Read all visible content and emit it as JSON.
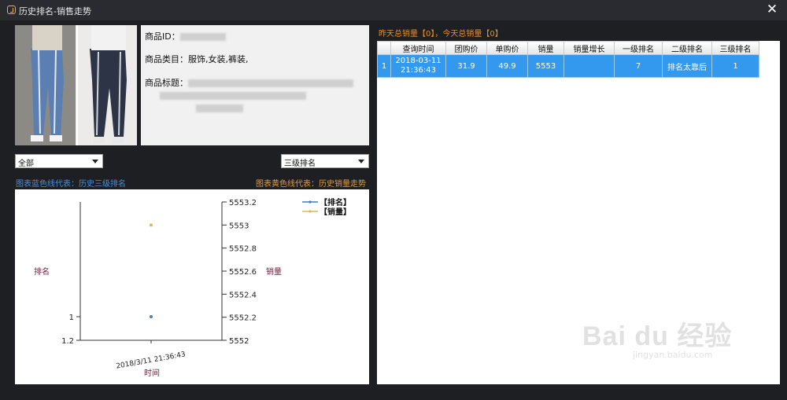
{
  "window": {
    "title": "历史排名-销售走势",
    "close_glyph": "✕"
  },
  "product": {
    "id_label": "商品ID：",
    "category_label": "商品类目：",
    "category_value": "服饰,女装,裤装,",
    "title_label": "商品标题："
  },
  "filters": {
    "left_select": "全部",
    "right_select": "三级排名"
  },
  "chart_legend_notes": {
    "blue": "图表蓝色线代表：历史三级排名",
    "orange": "图表黄色线代表：历史销量走势"
  },
  "sales_summary": "昨天总销量【0】，今天总销量【0】",
  "chart_data": {
    "type": "scatter",
    "x_categories": [
      "2018/3/11 21:36:43"
    ],
    "xlabel": "时间",
    "ylabel_left": "排名",
    "ylabel_right": "销量",
    "left_axis": {
      "ticks": [
        "1",
        "1.2"
      ],
      "reversed": true
    },
    "right_axis": {
      "ticks": [
        "5553.2",
        "5553",
        "5552.8",
        "5552.6",
        "5552.4",
        "5552.2",
        "5552"
      ],
      "ylim": [
        5552,
        5553.2
      ]
    },
    "series": [
      {
        "name": "【排名】",
        "axis": "left",
        "color": "#3d7fc4",
        "values": [
          1
        ]
      },
      {
        "name": "【销量】",
        "axis": "right",
        "color": "#e6b84a",
        "values": [
          5553
        ]
      }
    ]
  },
  "grid": {
    "columns": [
      "查询时间",
      "团购价",
      "单购价",
      "销量",
      "销量增长",
      "一级排名",
      "二级排名",
      "三级排名"
    ],
    "rows": [
      {
        "index": "1",
        "cells": [
          "2018-03-11 21:36:43",
          "31.9",
          "49.9",
          "5553",
          "",
          "7",
          "排名太靠后",
          "1"
        ]
      }
    ]
  },
  "watermark": {
    "main": "Bai du 经验",
    "sub": "jingyan.baidu.com"
  }
}
